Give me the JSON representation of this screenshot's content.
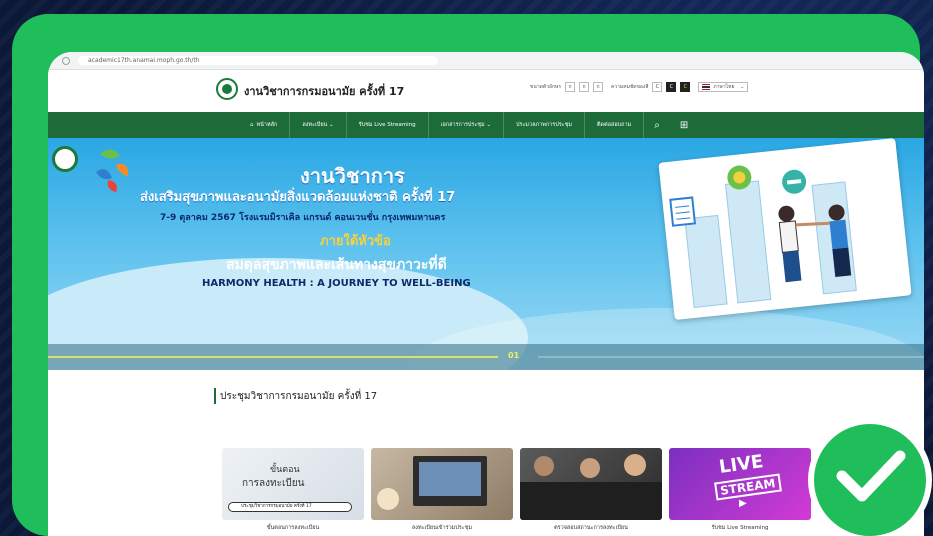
{
  "browser": {
    "url": "academic17th.anamai.moph.go.th/th"
  },
  "header": {
    "site_title": "งานวิชาการกรมอนามัย ครั้งที่ 17",
    "text_size_label": "ขนาดตัวอักษร",
    "text_size_options": [
      "ก",
      "ก",
      "ก"
    ],
    "contrast_label": "ความคมชัดของสี",
    "contrast_options": [
      "C",
      "C",
      "C"
    ],
    "language": "ภาษาไทย"
  },
  "nav": {
    "items": [
      "หน้าหลัก",
      "ลงทะเบียน ⌄",
      "รับชม Live Streaming",
      "เอกสารการประชุม ⌄",
      "ประมวลภาพการประชุม",
      "ติดต่อสอบถาม"
    ]
  },
  "hero": {
    "title": "งานวิชาการ",
    "subtitle": "ส่งเสริมสุขภาพและอนามัยสิ่งแวดล้อมแห่งชาติ ครั้งที่ 17",
    "date_line": "7-9 ตุลาคม 2567 โรงแรมมิราเคิล แกรนด์ คอนเวนชั่น กรุงเทพมหานคร",
    "under_label": "ภายใต้หัวข้อ",
    "theme_th": "สมดุลสุขภาพและเส้นทางสุขภาวะที่ดี",
    "theme_en": "HARMONY HEALTH : A JOURNEY TO WELL-BEING",
    "slide_number": "01"
  },
  "section": {
    "title": "ประชุมวิชาการกรมอนามัย ครั้งที่ 17"
  },
  "cards": [
    {
      "caption": "ขั้นตอนการลงทะเบียน",
      "line1": "ขั้นตอน",
      "line2": "การลงทะเบียน",
      "mini": "ประชุมวิชาการกรมอนามัย ครั้งที่ 17"
    },
    {
      "caption": "ลงทะเบียนเข้าร่วมประชุม"
    },
    {
      "caption": "ตรวจสอบสถานะการลงทะเบียน"
    },
    {
      "caption": "รับชม Live Streaming",
      "live": "LIVE",
      "stream": "STREAM"
    }
  ],
  "colors": {
    "frame": "#1fbe5a",
    "nav": "#1e6b3a",
    "background": "#0b1838"
  }
}
